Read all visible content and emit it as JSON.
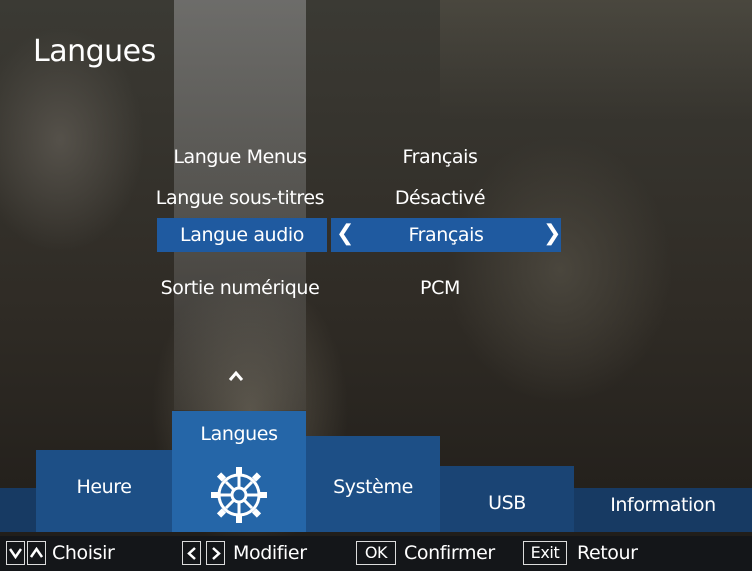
{
  "page": {
    "title": "Langues"
  },
  "settings": [
    {
      "label": "Langue Menus",
      "value": "Français"
    },
    {
      "label": "Langue sous-titres",
      "value": "Désactivé"
    },
    {
      "label": "Langue audio",
      "value": "Français",
      "selected": true
    },
    {
      "label": "Sortie numérique",
      "value": "PCM"
    }
  ],
  "selector": {
    "left_arrow": "❮",
    "right_arrow": "❯"
  },
  "tabs": [
    {
      "label": "Heure"
    },
    {
      "label": "Langues",
      "active": true,
      "icon": "gear-icon"
    },
    {
      "label": "Système"
    },
    {
      "label": "USB"
    },
    {
      "label": "Information"
    }
  ],
  "footer": {
    "choose_label": "Choisir",
    "modify_label": "Modifier",
    "ok_key": "OK",
    "confirm_label": "Confirmer",
    "exit_key": "Exit",
    "back_label": "Retour"
  },
  "colors": {
    "highlight": "#1f5aa0",
    "tab_active": "#2566a8",
    "tab_inactive": "#1d4f86",
    "band": "#173a63"
  }
}
